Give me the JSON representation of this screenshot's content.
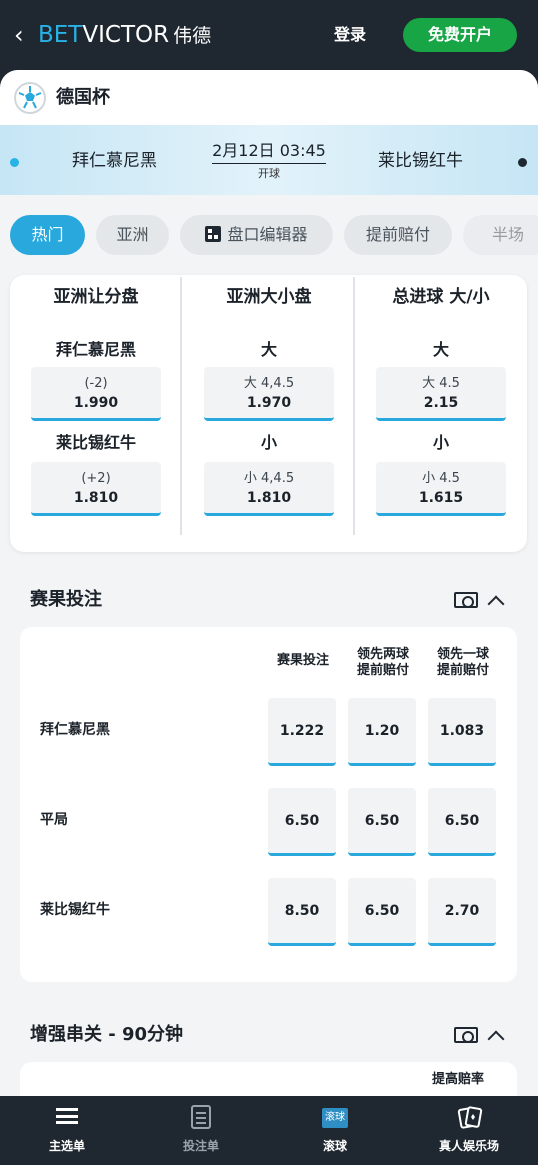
{
  "header": {
    "logo_bet": "BET",
    "logo_victor": "VICTOR",
    "logo_cn": "伟德",
    "login": "登录",
    "signup": "免费开户"
  },
  "competition": {
    "name": "德国杯"
  },
  "match": {
    "home": "拜仁慕尼黑",
    "away": "莱比锡红牛",
    "datetime": "2月12日 03:45",
    "status": "开球"
  },
  "tabs": [
    {
      "label": "热门",
      "active": true
    },
    {
      "label": "亚洲"
    },
    {
      "label": "盘口编辑器"
    },
    {
      "label": "提前赔付"
    },
    {
      "label": "半场"
    }
  ],
  "markets": [
    {
      "title": "亚洲让分盘",
      "selections": [
        {
          "label": "拜仁慕尼黑",
          "line": "(-2)",
          "price": "1.990"
        },
        {
          "label": "莱比锡红牛",
          "line": "(+2)",
          "price": "1.810"
        }
      ]
    },
    {
      "title": "亚洲大小盘",
      "selections": [
        {
          "label": "大",
          "line": "大 4,4.5",
          "price": "1.970"
        },
        {
          "label": "小",
          "line": "小 4,4.5",
          "price": "1.810"
        }
      ]
    },
    {
      "title": "总进球 大/小",
      "selections": [
        {
          "label": "大",
          "line": "大 4.5",
          "price": "2.15"
        },
        {
          "label": "小",
          "line": "小 4.5",
          "price": "1.615"
        }
      ]
    }
  ],
  "match_result": {
    "title": "赛果投注",
    "columns": [
      "赛果投注",
      "领先两球\n提前赔付",
      "领先一球\n提前赔付"
    ],
    "rows": [
      {
        "label": "拜仁慕尼黑",
        "odds": [
          "1.222",
          "1.20",
          "1.083"
        ]
      },
      {
        "label": "平局",
        "odds": [
          "6.50",
          "6.50",
          "6.50"
        ]
      },
      {
        "label": "莱比锡红牛",
        "odds": [
          "8.50",
          "6.50",
          "2.70"
        ]
      }
    ]
  },
  "parlay": {
    "title": "增强串关 - 90分钟",
    "column": "提高赔率"
  },
  "bottom_nav": [
    {
      "label": "主选单"
    },
    {
      "label": "投注单"
    },
    {
      "label": "滚球",
      "badge": "滚球"
    },
    {
      "label": "真人娱乐场"
    }
  ],
  "colors": {
    "accent": "#28a8dc",
    "signup_green": "#18a546",
    "dark": "#1f2830"
  }
}
